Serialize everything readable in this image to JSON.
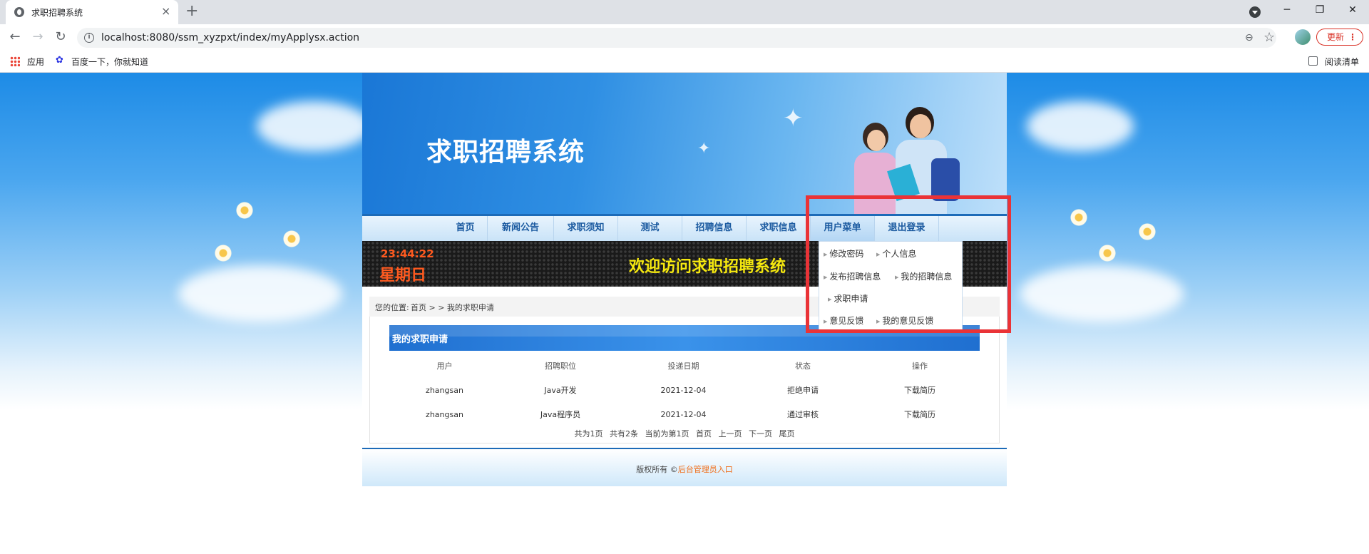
{
  "browser": {
    "tab_title": "求职招聘系统",
    "url": "localhost:8080/ssm_xyzpxt/index/myApplysx.action",
    "update_label": "更新",
    "bookmarks": [
      "应用",
      "百度一下，你就知道"
    ],
    "reading_list": "阅读清单"
  },
  "site": {
    "title": "求职招聘系统",
    "nav": [
      "首页",
      "新闻公告",
      "求职须知",
      "测试",
      "招聘信息",
      "求职信息",
      "用户菜单",
      "退出登录"
    ],
    "clock": "23:44:22",
    "weekday": "星期日",
    "welcome": "欢迎访问求职招聘系统",
    "breadcrumb_label": "您的位置:",
    "breadcrumb_path": "首页 > > 我的求职申请"
  },
  "user_menu": {
    "items": [
      "修改密码",
      "个人信息",
      "发布招聘信息",
      "我的招聘信息",
      "求职申请",
      "意见反馈",
      "我的意见反馈"
    ]
  },
  "applications": {
    "title": "我的求职申请",
    "columns": [
      "用户",
      "招聘职位",
      "投递日期",
      "状态",
      "操作"
    ],
    "rows": [
      [
        "zhangsan",
        "Java开发",
        "2021-12-04",
        "拒绝申请",
        "下载简历"
      ],
      [
        "zhangsan",
        "Java程序员",
        "2021-12-04",
        "通过审核",
        "下载简历"
      ]
    ]
  },
  "pager": {
    "total_pages": "共为1页",
    "total_items": "共有2条",
    "current": "当前为第1页",
    "first": "首页",
    "prev": "上一页",
    "next": "下一页",
    "last": "尾页"
  },
  "footer": {
    "copyright": "版权所有 ©",
    "admin_link": "后台管理员入口"
  }
}
